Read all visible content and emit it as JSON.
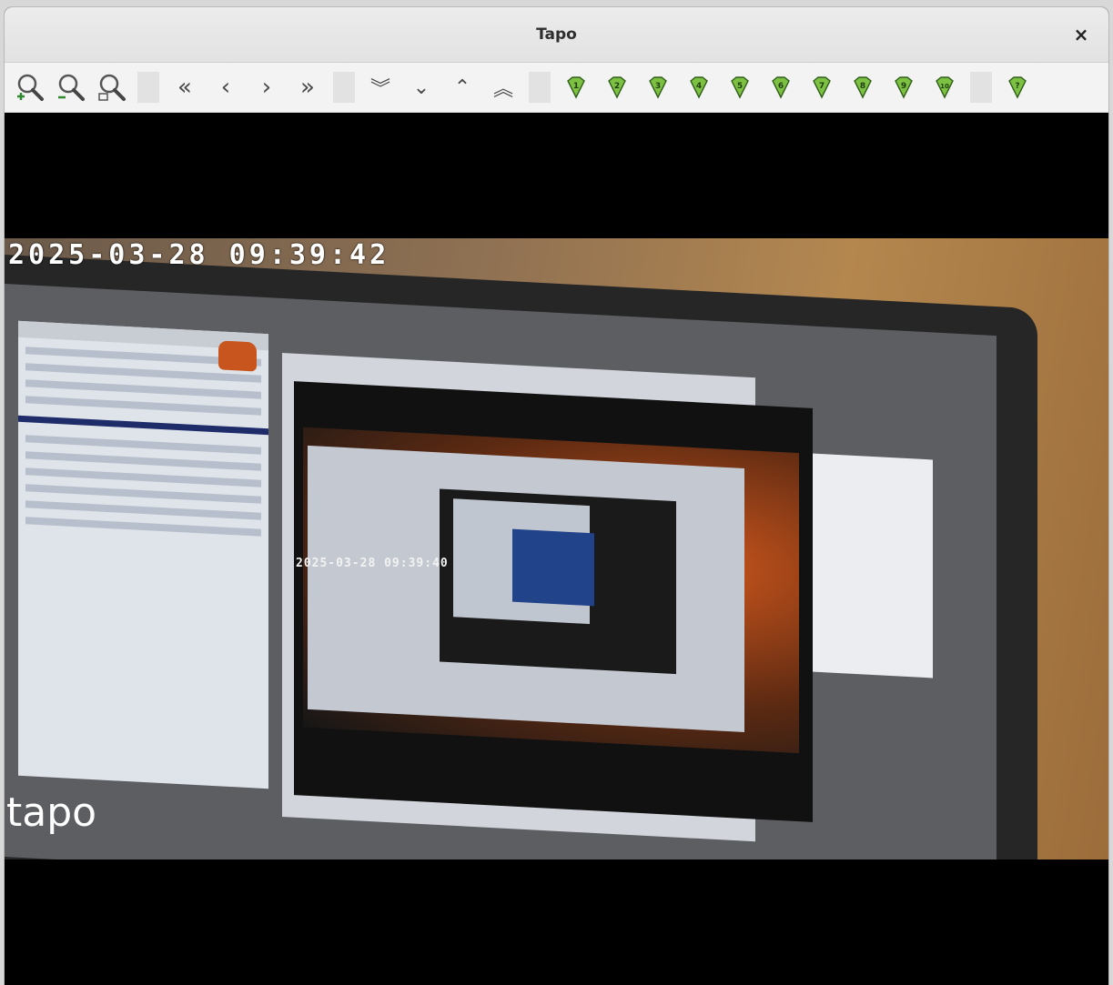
{
  "window": {
    "title": "Tapo",
    "close_glyph": "×"
  },
  "toolbar": {
    "zoom": [
      {
        "icon": "zoom-in-icon"
      },
      {
        "icon": "zoom-out-icon"
      },
      {
        "icon": "zoom-fit-icon"
      }
    ],
    "horizontal_nav": [
      {
        "icon": "first-icon",
        "glyph": "«"
      },
      {
        "icon": "previous-icon",
        "glyph": "‹"
      },
      {
        "icon": "next-icon",
        "glyph": "›"
      },
      {
        "icon": "last-icon",
        "glyph": "»"
      }
    ],
    "vertical_nav": [
      {
        "icon": "double-down-icon",
        "glyph": "︾"
      },
      {
        "icon": "down-icon",
        "glyph": "⌄"
      },
      {
        "icon": "up-icon",
        "glyph": "⌃"
      },
      {
        "icon": "double-up-icon",
        "glyph": "︽"
      }
    ],
    "presets": [
      "1",
      "2",
      "3",
      "4",
      "5",
      "6",
      "7",
      "8",
      "9",
      "10"
    ],
    "extra_preset": {
      "icon": "preset-help-icon",
      "glyph": "?"
    },
    "gem_color": "#7dc142"
  },
  "video": {
    "timestamp": "2025-03-28  09:39:42",
    "inner_timestamp": "2025-03-28 09:39:40",
    "logo": "tapo"
  }
}
